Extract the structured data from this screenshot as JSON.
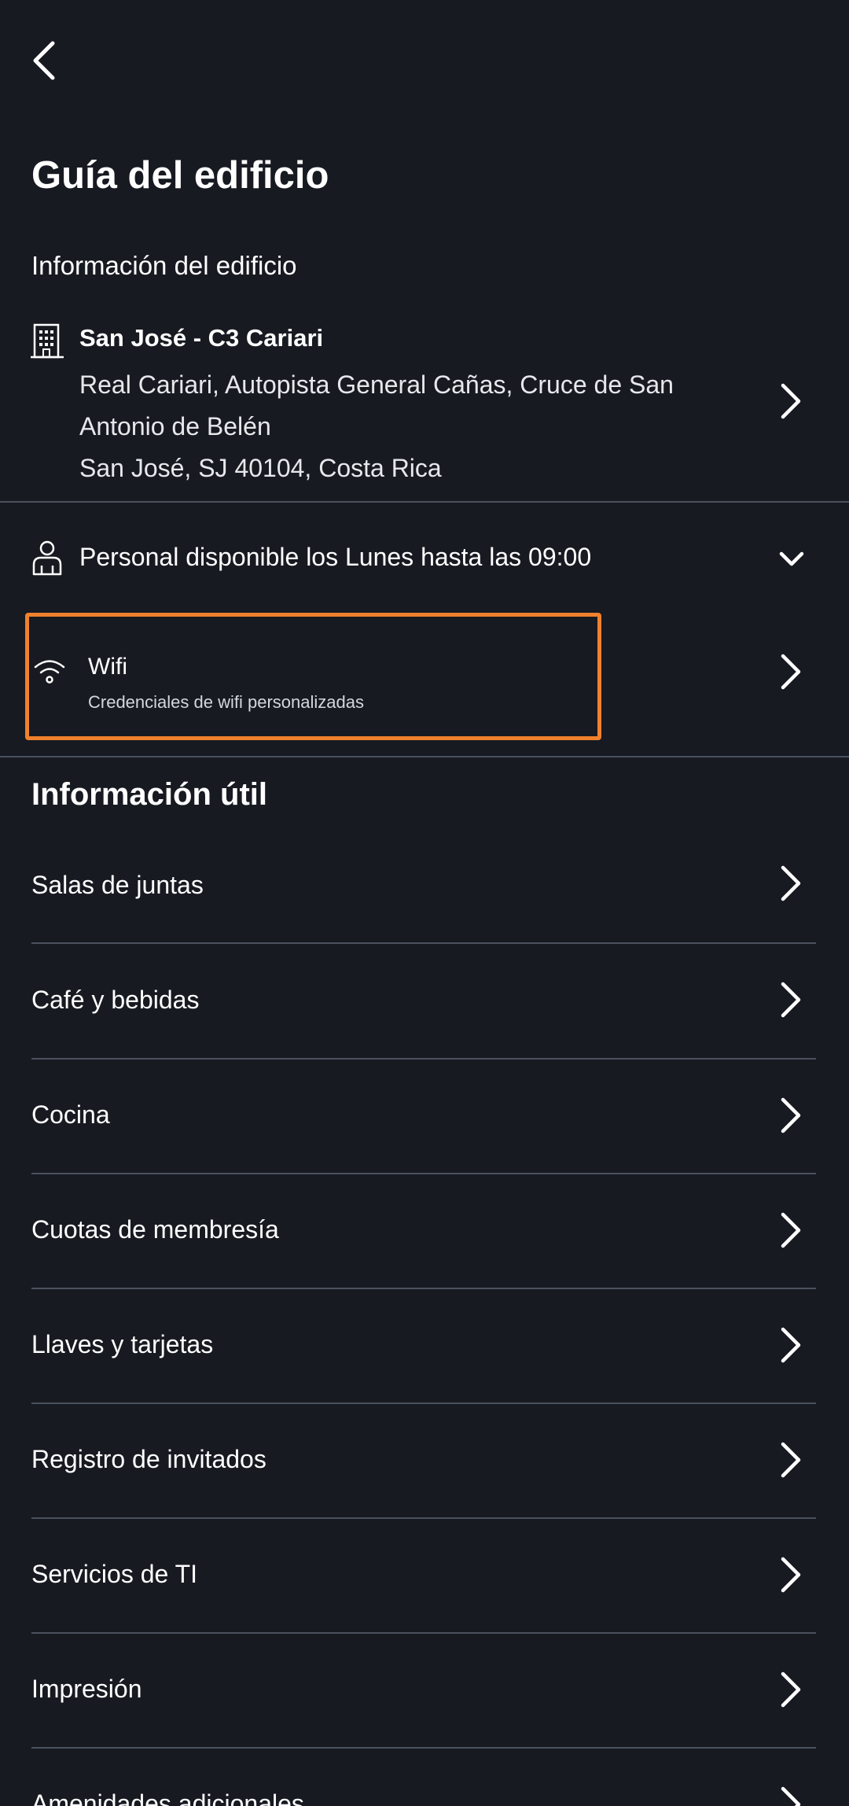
{
  "header": {
    "back_icon": "chevron-left-icon",
    "title": "Guía del edificio"
  },
  "building_section": {
    "label": "Información del edificio",
    "icon": "building-icon",
    "name": "San José - C3 Cariari",
    "address_lines": [
      "Real Cariari, Autopista General Cañas, Cruce de San",
      "Antonio de Belén",
      "San José, SJ 40104, Costa Rica"
    ]
  },
  "staff": {
    "icon": "staff-person-icon",
    "text": "Personal disponible los Lunes hasta las 09:00"
  },
  "wifi": {
    "icon": "wifi-icon",
    "title": "Wifi",
    "subtitle": "Credenciales de wifi personalizadas"
  },
  "useful_info": {
    "title": "Información útil",
    "items": [
      "Salas de juntas",
      "Café y bebidas",
      "Cocina",
      "Cuotas de membresía",
      "Llaves y tarjetas",
      "Registro de invitados",
      "Servicios de TI",
      "Impresión",
      "Amenidades adicionales"
    ]
  },
  "colors": {
    "background": "#171a21",
    "divider": "#4a505d",
    "highlight": "#f0812d",
    "text": "#ffffff"
  }
}
